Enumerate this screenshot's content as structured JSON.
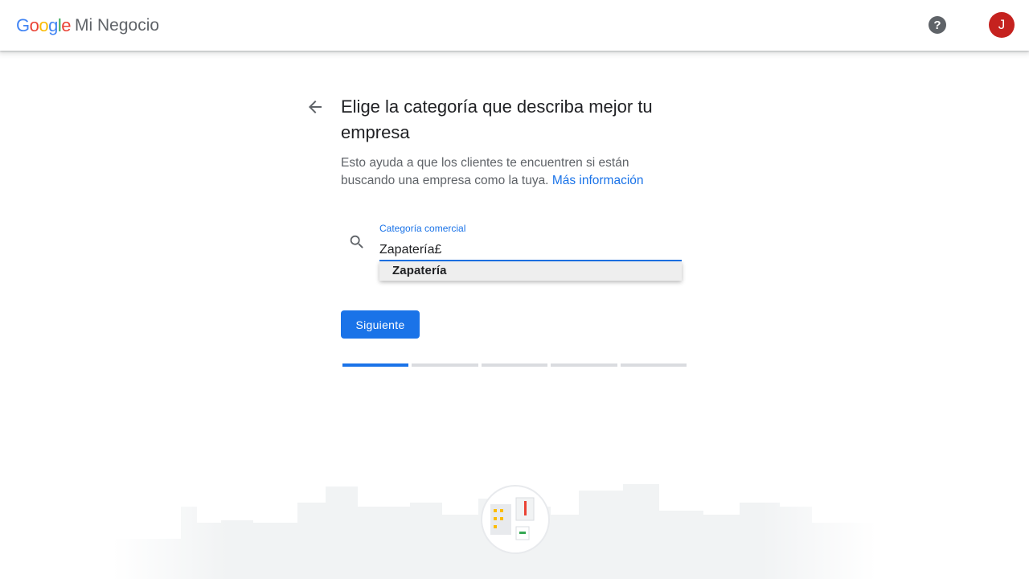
{
  "header": {
    "logo_google_letters": [
      "G",
      "o",
      "o",
      "g",
      "l",
      "e"
    ],
    "logo_google_colors": [
      "#4285F4",
      "#EA4335",
      "#FBBC05",
      "#4285F4",
      "#34A853",
      "#EA4335"
    ],
    "product_name": "Mi Negocio",
    "help_icon": "help-icon",
    "help_glyph": "?",
    "avatar_initial": "J",
    "avatar_color": "#c5221f"
  },
  "main": {
    "title": "Elige la categoría que describa mejor tu empresa",
    "description": "Esto ayuda a que los clientes te encuentren si están buscando una empresa como la tuya.",
    "learn_more": "Más información",
    "field": {
      "label": "Categoría comercial",
      "value": "Zapatería£"
    },
    "suggestions": [
      "Zapatería"
    ],
    "next_button": "Siguiente",
    "progress": {
      "total_steps": 5,
      "current_step": 1
    }
  },
  "colors": {
    "accent": "#1a73e8",
    "text": "#202124",
    "secondary": "#5f6368"
  }
}
